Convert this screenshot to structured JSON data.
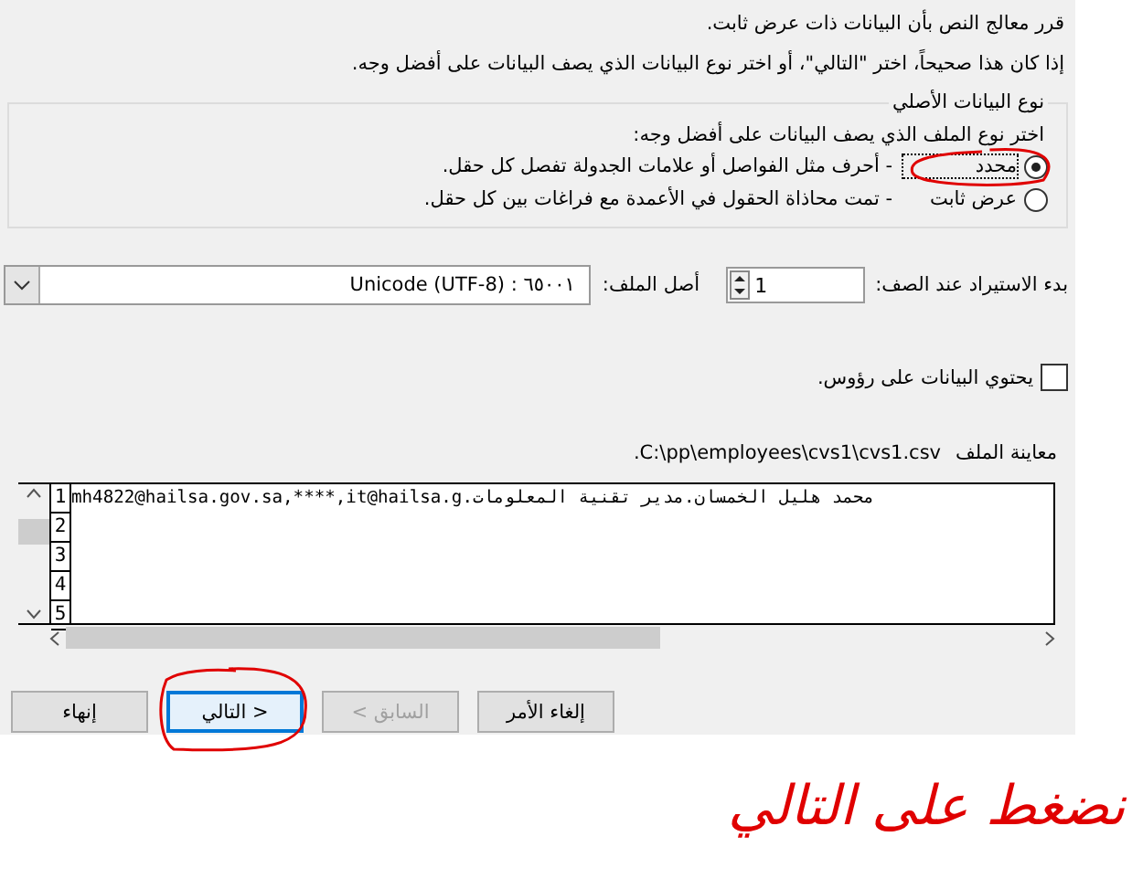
{
  "intro": [
    "قرر معالج النص بأن البيانات ذات عرض ثابت.",
    "إذا كان هذا صحيحاً، اختر \"التالي\"، أو اختر نوع البيانات الذي يصف البيانات على أفضل وجه."
  ],
  "data_type": {
    "legend": "نوع البيانات الأصلي",
    "prompt": "اختر نوع الملف الذي يصف البيانات على أفضل وجه:",
    "options": [
      {
        "label": "محدد",
        "description": "- أحرف مثل الفواصل أو علامات الجدولة تفصل كل حقل.",
        "selected": true,
        "circled": true
      },
      {
        "label": "عرض ثابت",
        "description": "- تمت محاذاة الحقول في الأعمدة مع فراغات بين كل حقل.",
        "selected": false,
        "circled": false
      }
    ]
  },
  "start_row": {
    "label": "بدء الاستيراد عند الصف:",
    "value": "1"
  },
  "file_origin": {
    "label": "أصل الملف:",
    "value": "٦٥٠٠١ : Unicode (UTF-8)"
  },
  "headers": {
    "label": "يحتوي البيانات على رؤوس.",
    "checked": false
  },
  "preview": {
    "label": "معاينة الملف",
    "path": "C:\\pp\\employees\\cvs1\\cvs1.csv.",
    "line_numbers": [
      "1",
      "2",
      "3",
      "4",
      "5"
    ],
    "lines": [
      "mh4822@hailsa.gov.sa,****,it@hailsa.g.محمد هليل الخمسان.مدير تقنية المعلومات"
    ]
  },
  "buttons": [
    {
      "label": "إلغاء الأمر",
      "disabled": false,
      "focused": false,
      "circled": false
    },
    {
      "label": "< السابق",
      "disabled": true,
      "focused": false,
      "circled": false
    },
    {
      "label": "التالي >",
      "disabled": false,
      "focused": true,
      "circled": true
    },
    {
      "label": "إنهاء",
      "disabled": false,
      "focused": false,
      "circled": false
    }
  ],
  "annotation": {
    "text": "نضغط على التالي"
  }
}
